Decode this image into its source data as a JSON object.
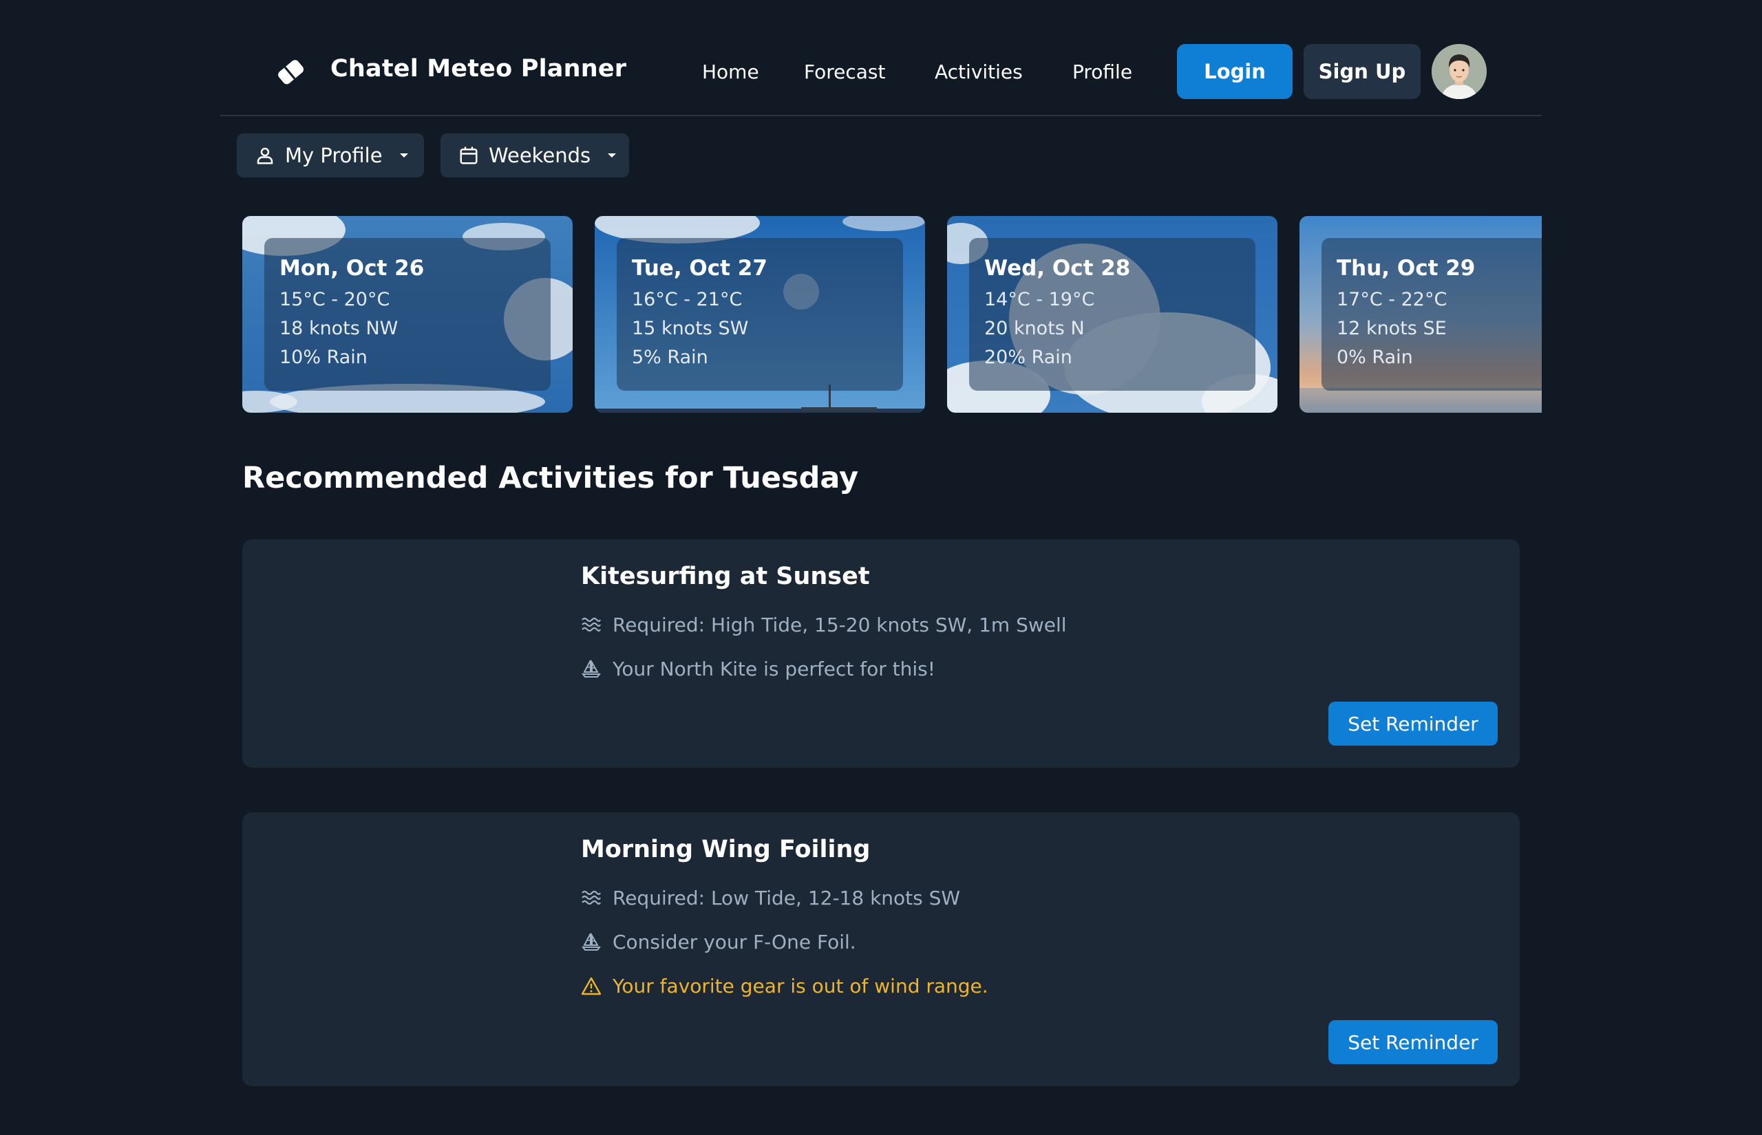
{
  "app": {
    "title": "Chatel Meteo Planner",
    "logo_icon": "tag-icon"
  },
  "nav": {
    "items": [
      {
        "label": "Home"
      },
      {
        "label": "Forecast"
      },
      {
        "label": "Activities"
      },
      {
        "label": "Profile"
      }
    ]
  },
  "auth": {
    "login_label": "Login",
    "signup_label": "Sign Up",
    "avatar_icon": "user-avatar"
  },
  "filters": {
    "profile": {
      "label": "My Profile",
      "icon": "person-icon",
      "caret_icon": "caret-down-icon"
    },
    "period": {
      "label": "Weekends",
      "icon": "calendar-icon",
      "caret_icon": "caret-down-icon"
    }
  },
  "forecast": {
    "days": [
      {
        "title": "Mon, Oct 26",
        "temp": "15°C - 20°C",
        "wind": "18 knots NW",
        "rain": "10% Rain",
        "sky": "cloudy-blue"
      },
      {
        "title": "Tue, Oct 27",
        "temp": "16°C - 21°C",
        "wind": "15 knots SW",
        "rain": "5% Rain",
        "sky": "clear-blue"
      },
      {
        "title": "Wed, Oct 28",
        "temp": "14°C - 19°C",
        "wind": "20 knots N",
        "rain": "20% Rain",
        "sky": "big-clouds"
      },
      {
        "title": "Thu, Oct 29",
        "temp": "17°C - 22°C",
        "wind": "12 knots SE",
        "rain": "0% Rain",
        "sky": "sunset-sea"
      }
    ]
  },
  "recommended": {
    "title": "Recommended Activities for Tuesday",
    "activities": [
      {
        "title": "Kitesurfing at Sunset",
        "lines": [
          {
            "icon": "waves-icon",
            "text": "Required: High Tide, 15-20 knots SW, 1m Swell"
          },
          {
            "icon": "sailboat-icon",
            "text": "Your North Kite is perfect for this!"
          }
        ],
        "button_label": "Set Reminder"
      },
      {
        "title": "Morning Wing Foiling",
        "lines": [
          {
            "icon": "waves-icon",
            "text": "Required: Low Tide, 12-18 knots SW"
          },
          {
            "icon": "sailboat-icon",
            "text": "Consider your F-One Foil."
          },
          {
            "icon": "warning-icon",
            "text": "Your favorite gear is out of wind range."
          }
        ],
        "button_label": "Set Reminder"
      }
    ]
  },
  "colors": {
    "background": "#111a24",
    "primary": "#0f7fd6",
    "surface": "#1c2836",
    "muted_text": "#9fb0c2",
    "warning": "#f0b429"
  }
}
